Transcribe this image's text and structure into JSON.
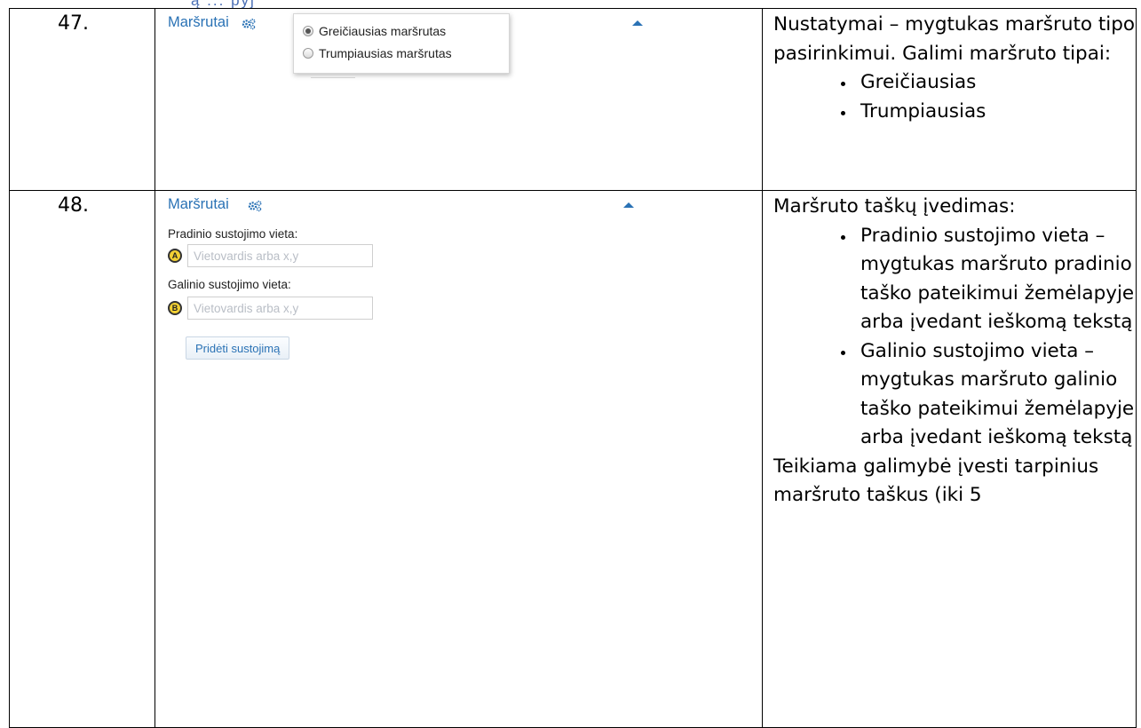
{
  "top_fragment": "ą ... pyj",
  "rows": [
    {
      "number": "47.",
      "ui": {
        "panel_title": "Maršrutai",
        "route_options": [
          {
            "label": "Greičiausias maršrutas",
            "checked": true
          },
          {
            "label": "Trumpiausias maršrutas",
            "checked": false
          }
        ]
      },
      "description": {
        "intro": "Nustatymai – mygtukas maršruto tipo pasirinkimui. Galimi maršruto tipai:",
        "bullets": [
          "Greičiausias",
          "Trumpiausias"
        ]
      }
    },
    {
      "number": "48.",
      "ui": {
        "panel_title": "Maršrutai",
        "start_label": "Pradinio sustojimo vieta:",
        "start_marker": "A",
        "start_placeholder": "Vietovardis arba x,y",
        "end_label": "Galinio sustojimo vieta:",
        "end_marker": "B",
        "end_placeholder": "Vietovardis arba x,y",
        "add_stop_label": "Pridėti sustojimą"
      },
      "description": {
        "intro": "Maršruto taškų įvedimas:",
        "bullets": [
          "Pradinio sustojimo vieta – mygtukas maršruto pradinio taško pateikimui žemėlapyje arba įvedant ieškomą tekstą",
          "Galinio sustojimo vieta – mygtukas maršruto galinio  taško pateikimui žemėlapyje arba įvedant ieškomą tekstą"
        ],
        "outro": "Teikiama galimybė įvesti tarpinius maršruto taškus (iki 5"
      }
    }
  ],
  "colors": {
    "accent": "#2a72b5",
    "marker": "#f2d033"
  },
  "icons": [
    "gear-icon",
    "caret-up-icon",
    "radio-icon"
  ]
}
